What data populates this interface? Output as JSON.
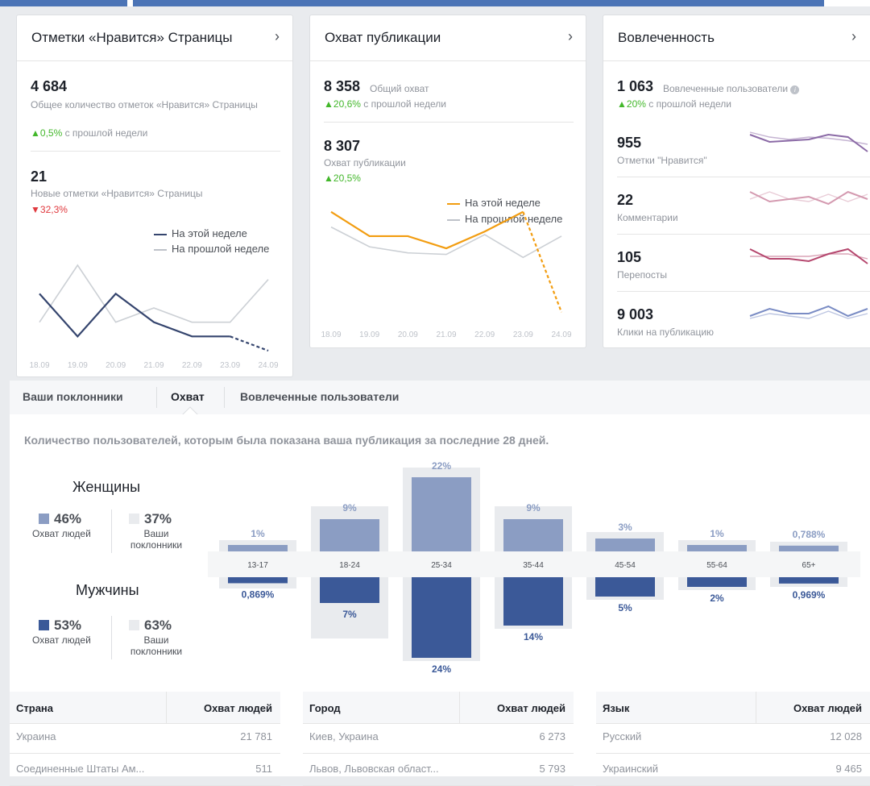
{
  "likes_card": {
    "title": "Отметки «Нравится» Страницы",
    "total_value": "4 684",
    "total_label": "Общее количество отметок «Нравится» Страницы",
    "total_change": "0,5%",
    "total_change_text": "с прошлой недели",
    "new_value": "21",
    "new_label": "Новые отметки «Нравится» Страницы",
    "new_change": "32,3%",
    "legend_this": "На этой неделе",
    "legend_prev": "На прошлой неделе",
    "dates": [
      "18.09",
      "19.09",
      "20.09",
      "21.09",
      "22.09",
      "23.09",
      "24.09"
    ],
    "this_week": [
      4,
      1,
      4,
      2,
      1,
      1,
      0
    ],
    "prev_week": [
      2,
      6,
      2,
      3,
      2,
      2,
      5
    ]
  },
  "reach_card": {
    "title": "Охват публикации",
    "total_value": "8 358",
    "total_label": "Общий охват",
    "total_change": "20,6%",
    "total_change_text": "с прошлой недели",
    "post_value": "8 307",
    "post_label": "Охват публикации",
    "post_change": "20,5%",
    "legend_this": "На этой неделе",
    "legend_prev": "На прошлой неделе",
    "dates": [
      "18.09",
      "19.09",
      "20.09",
      "21.09",
      "22.09",
      "23.09",
      "24.09"
    ],
    "this_week": [
      1380,
      1220,
      1220,
      1140,
      1250,
      1380,
      720
    ],
    "prev_week": [
      1280,
      1150,
      1110,
      1100,
      1230,
      1080,
      1220
    ]
  },
  "engagement_card": {
    "title": "Вовлеченность",
    "total_value": "1 063",
    "total_label": "Вовлеченные пользователи",
    "total_change": "20%",
    "total_change_text": "с прошлой недели",
    "rows": [
      {
        "value": "955",
        "label": "Отметки \"Нравится\"",
        "color": "#8b6aa6"
      },
      {
        "value": "22",
        "label": "Комментарии",
        "color": "#d49ab0"
      },
      {
        "value": "105",
        "label": "Перепосты",
        "color": "#b5476e"
      },
      {
        "value": "9 003",
        "label": "Клики на публикацию",
        "color": "#7a8cc4"
      }
    ]
  },
  "tabs": [
    "Ваши поклонники",
    "Охват",
    "Вовлеченные пользователи"
  ],
  "audience": {
    "description": "Количество пользователей, которым была показана ваша публикация за последние 28 дней.",
    "women_label": "Женщины",
    "men_label": "Мужчины",
    "women_reach": "46%",
    "women_fans": "37%",
    "men_reach": "53%",
    "men_fans": "63%",
    "reach_label": "Охват людей",
    "fans_label": "Ваши поклонники",
    "colors": {
      "women": "#8b9dc3",
      "men": "#3b5998",
      "fans": "#e9ebee"
    }
  },
  "chart_data": {
    "type": "bar",
    "categories": [
      "13-17",
      "18-24",
      "25-34",
      "35-44",
      "45-54",
      "55-64",
      "65+"
    ],
    "series": [
      {
        "name": "Женщины",
        "labels": [
          "1%",
          "9%",
          "22%",
          "9%",
          "3%",
          "1%",
          "0,788%"
        ],
        "values": [
          1,
          9,
          22,
          9,
          3,
          1,
          0.788
        ]
      },
      {
        "name": "Мужчины",
        "labels": [
          "0,869%",
          "7%",
          "24%",
          "14%",
          "5%",
          "2%",
          "0,969%"
        ],
        "values": [
          0.869,
          7,
          24,
          14,
          5,
          2,
          0.969
        ]
      }
    ],
    "fans_women": [
      1.5,
      12,
      24,
      12,
      4,
      1.5,
      1
    ],
    "fans_men": [
      1.5,
      17,
      24,
      14,
      5,
      2,
      1
    ]
  },
  "tables": [
    {
      "col1": "Страна",
      "col2": "Охват людей",
      "rows": [
        [
          "Украина",
          "21 781"
        ],
        [
          "Соединенные Штаты Ам...",
          "511"
        ]
      ]
    },
    {
      "col1": "Город",
      "col2": "Охват людей",
      "rows": [
        [
          "Киев, Украина",
          "6 273"
        ],
        [
          "Львов, Львовская област...",
          "5 793"
        ]
      ]
    },
    {
      "col1": "Язык",
      "col2": "Охват людей",
      "rows": [
        [
          "Русский",
          "12 028"
        ],
        [
          "Украинский",
          "9 465"
        ]
      ]
    }
  ]
}
